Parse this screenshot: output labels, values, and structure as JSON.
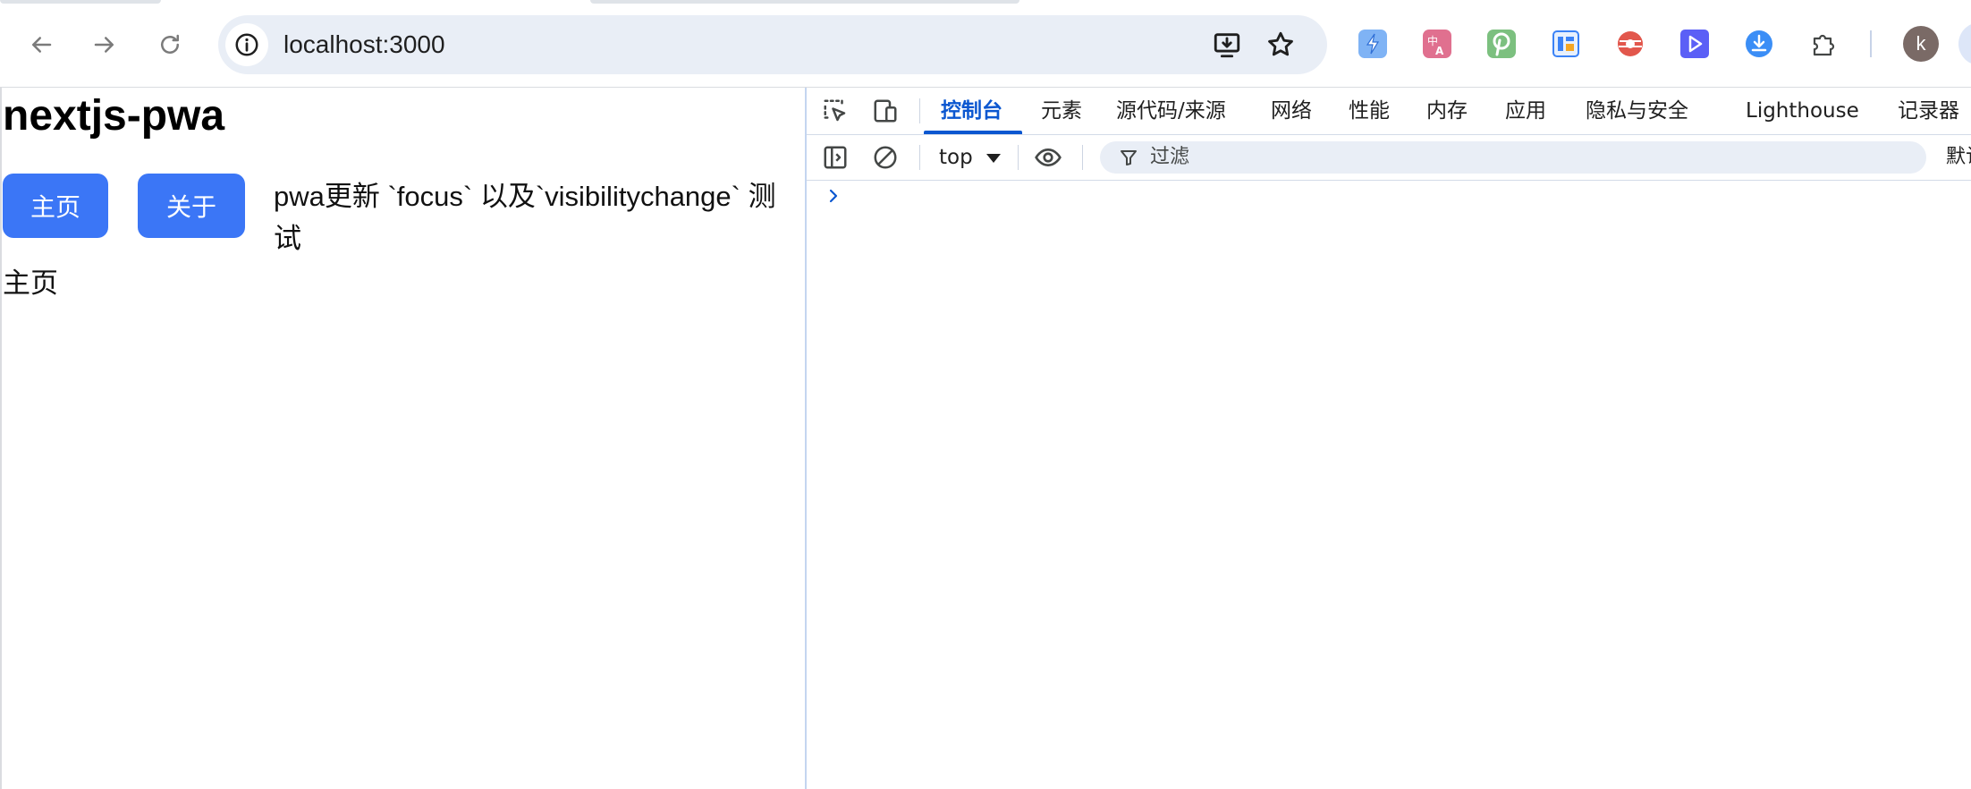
{
  "browser": {
    "url": "localhost:3000",
    "nav": {
      "back_icon": "arrow-left-icon",
      "forward_icon": "arrow-right-icon",
      "reload_icon": "reload-icon"
    },
    "omnibox_icons": [
      "site-info-icon",
      "install-app-icon",
      "bookmark-star-icon"
    ],
    "extensions": [
      {
        "name": "bolt-extension-icon",
        "color": "#5a9cf0"
      },
      {
        "name": "translate-extension-icon",
        "color": "#d9577a"
      },
      {
        "name": "pinterest-extension-icon",
        "color": "#67b36a"
      },
      {
        "name": "layout-extension-icon",
        "color": "#3b82f6"
      },
      {
        "name": "disc-extension-icon",
        "color": "#e2574c"
      },
      {
        "name": "play-extension-icon",
        "color": "#5b5ff6"
      },
      {
        "name": "download-extension-icon",
        "color": "#3b8ef6"
      },
      {
        "name": "puzzle-extensions-icon",
        "color": "#444746"
      }
    ],
    "profile_initial": "k"
  },
  "page": {
    "title": "nextjs-pwa",
    "buttons": {
      "home": "主页",
      "about": "关于"
    },
    "description": "pwa更新 `focus` 以及`visibilitychange` 测试",
    "body_text": "主页",
    "accent_color": "#3b76f6"
  },
  "devtools": {
    "tabs": [
      "控制台",
      "元素",
      "源代码/来源",
      "网络",
      "性能",
      "内存",
      "应用",
      "隐私与安全",
      "Lighthouse",
      "记录器"
    ],
    "active_tab_index": 0,
    "console": {
      "context": "top",
      "filter_placeholder": "过滤",
      "levels_label": "默认级别"
    },
    "accent_color": "#0b57d0"
  }
}
